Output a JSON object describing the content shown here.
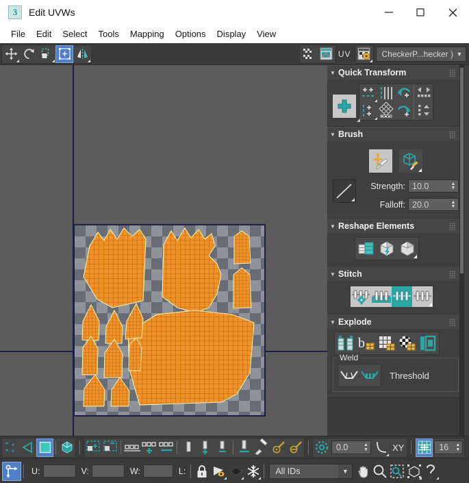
{
  "window": {
    "title": "Edit UVWs",
    "app_icon": "max-logo-icon",
    "minimize": "—",
    "maximize": "☐",
    "close": "✕"
  },
  "menubar": {
    "items": [
      {
        "label": "File"
      },
      {
        "label": "Edit"
      },
      {
        "label": "Select"
      },
      {
        "label": "Tools"
      },
      {
        "label": "Mapping"
      },
      {
        "label": "Options"
      },
      {
        "label": "Display"
      },
      {
        "label": "View"
      }
    ]
  },
  "top_toolbar": {
    "transform_tools": [
      {
        "name": "move-tool",
        "icon": "move-icon",
        "active": false
      },
      {
        "name": "rotate-tool",
        "icon": "rotate-icon",
        "active": false
      },
      {
        "name": "scale-tool",
        "icon": "scale-icon",
        "active": false
      },
      {
        "name": "freeform-mode-tool",
        "icon": "freeform-gizmo-icon",
        "active": true
      },
      {
        "name": "mirror-tool",
        "icon": "mirror-icon",
        "active": false
      }
    ],
    "display_tools": [
      {
        "name": "show-map-toggle",
        "icon": "checker-dots-icon"
      },
      {
        "name": "show-map-button",
        "icon": "map-window-icon"
      }
    ],
    "uv_label": "UV",
    "material_id_button": "material-gear-icon",
    "map_dropdown": {
      "value": "CheckerP...hecker )",
      "arrow": "▼"
    }
  },
  "canvas": {
    "background_color": "#5b5b5b",
    "grid_color": "#1e1e44",
    "uv_tile": {
      "checker_light": "#8f9299",
      "checker_dark": "#686c74",
      "border_color": "#1e1e44"
    },
    "mesh": {
      "fill_color": "#f0932a",
      "edge_color": "#c96a12",
      "outline_color": "#f5f0a0",
      "island_count": 14,
      "description": "unwrapped UV islands of a gloved hand mesh — two palm shells, one large cuff panel, and eleven finger/thumb tubes"
    }
  },
  "panel": {
    "rollouts": [
      {
        "name": "quick-transform",
        "title": "Quick Transform",
        "triangle": "▼",
        "collapsed": false,
        "buttons": [
          {
            "name": "quick-transform-pivot",
            "icon": "pivot-cross-icon"
          },
          {
            "name": "align-horizontal",
            "icon": "align-h-icon"
          },
          {
            "name": "align-vertical",
            "icon": "align-v-icon"
          },
          {
            "name": "space-vertical",
            "icon": "space-v-bars-icon"
          },
          {
            "name": "rotate-ccw-90",
            "icon": "rotate-ccw-icon"
          },
          {
            "name": "align-linear-h",
            "icon": "align-linear-h-icon"
          },
          {
            "name": "align-linear-v",
            "icon": "align-linear-v-icon"
          },
          {
            "name": "align-to-diamond",
            "icon": "diamond-grid-icon"
          },
          {
            "name": "space-horizontal",
            "icon": "space-h-bar-icon"
          },
          {
            "name": "rotate-cw-90",
            "icon": "rotate-cw-icon"
          },
          {
            "name": "snap-horizontal",
            "icon": "snap-lr-icon"
          },
          {
            "name": "snap-vertical",
            "icon": "snap-ud-icon"
          }
        ]
      },
      {
        "name": "brush",
        "title": "Brush",
        "triangle": "▼",
        "collapsed": false,
        "buttons": [
          {
            "name": "paint-move-brush",
            "icon": "paint-move-icon"
          },
          {
            "name": "relax-brush",
            "icon": "relax-cube-brush-icon"
          }
        ],
        "curve_button": {
          "name": "falloff-curve-button",
          "icon": "falloff-curve-icon"
        },
        "fields": [
          {
            "name": "brush-strength",
            "label": "Strength:",
            "value": "10.0"
          },
          {
            "name": "brush-falloff",
            "label": "Falloff:",
            "value": "20.0"
          }
        ]
      },
      {
        "name": "reshape-elements",
        "title": "Reshape Elements",
        "triangle": "▼",
        "collapsed": false,
        "buttons": [
          {
            "name": "relax-button",
            "icon": "relax-panels-icon"
          },
          {
            "name": "quick-peel-button",
            "icon": "peel-lightning-cube-icon"
          },
          {
            "name": "peel-mode-button",
            "icon": "peel-cube-icon"
          }
        ]
      },
      {
        "name": "stitch",
        "title": "Stitch",
        "triangle": "▼",
        "collapsed": false,
        "buttons": [
          {
            "name": "stitch-custom-button",
            "icon": "stitch-gear-icon"
          },
          {
            "name": "stitch-selected-button",
            "icon": "stitch-selected-icon"
          },
          {
            "name": "stitch-diagonal-button",
            "icon": "stitch-diagonal-icon"
          },
          {
            "name": "stitch-source-button",
            "icon": "stitch-source-icon"
          }
        ]
      },
      {
        "name": "explode",
        "title": "Explode",
        "triangle": "▼",
        "collapsed": false,
        "buttons": [
          {
            "name": "break-button",
            "icon": "break-arrows-icon"
          },
          {
            "name": "break-by-angle-button",
            "icon": "break-angle-icon"
          },
          {
            "name": "break-by-face-button",
            "icon": "break-grid-icon"
          },
          {
            "name": "break-by-material-button",
            "icon": "break-checker-icon"
          },
          {
            "name": "break-by-element-button",
            "icon": "break-element-icon"
          }
        ],
        "weld_group": {
          "name": "weld-group",
          "legend": "Weld",
          "threshold_label": "Threshold",
          "buttons": [
            {
              "name": "weld-selected-button",
              "icon": "weld-open-icon"
            },
            {
              "name": "target-weld-button",
              "icon": "weld-target-icon"
            }
          ]
        }
      }
    ],
    "scrollbar": {
      "name": "panel-scrollbar"
    }
  },
  "bottom_toolbar": {
    "selection_modes": [
      {
        "name": "vertex-mode",
        "icon": "vertex-dots-icon",
        "active": false
      },
      {
        "name": "edge-mode",
        "icon": "edge-triangle-icon",
        "active": false
      },
      {
        "name": "face-mode",
        "icon": "face-square-icon",
        "active": true
      },
      {
        "name": "element-mode",
        "icon": "element-cube-icon",
        "active": false
      }
    ],
    "selection_tools": [
      {
        "name": "expand-selection",
        "icon": "expand-select-icon"
      },
      {
        "name": "shrink-selection",
        "icon": "shrink-select-icon"
      },
      {
        "name": "loop-uv-edges",
        "icon": "loop-uv-icon"
      },
      {
        "name": "grow-loop-uv",
        "icon": "grow-loop-icon"
      },
      {
        "name": "ring-uv-edges",
        "icon": "ring-uv-icon"
      },
      {
        "name": "loop-uv-vertical",
        "icon": "loop-v-icon"
      },
      {
        "name": "grow-loop-vertical",
        "icon": "grow-loop-v-icon"
      },
      {
        "name": "shrink-loop-vertical",
        "icon": "shrink-loop-v-icon"
      },
      {
        "name": "align-to-edge",
        "icon": "align-edge-icon"
      },
      {
        "name": "paint-select-brush",
        "icon": "paint-brush-icon"
      },
      {
        "name": "paint-select-inc",
        "icon": "brush-plus-icon"
      },
      {
        "name": "paint-select-dec",
        "icon": "brush-minus-icon"
      }
    ],
    "snap": {
      "name": "snap-toggle",
      "icon": "snap-ring-icon",
      "value": "0.0",
      "curve_icon": "falloff-curve-icon",
      "axis_label": "XY"
    },
    "grid": {
      "name": "grid-toggle",
      "icon": "grid-snap-icon",
      "active": true,
      "value": "16"
    }
  },
  "status_bar": {
    "pivot_button": {
      "name": "pivot-snap-button",
      "icon": "pivot-arrow-icon",
      "active": true
    },
    "coords": [
      {
        "name": "u-field",
        "label": "U:",
        "value": ""
      },
      {
        "name": "v-field",
        "label": "V:",
        "value": ""
      },
      {
        "name": "w-field",
        "label": "W:",
        "value": ""
      },
      {
        "name": "l-field",
        "label": "L:",
        "value": ""
      }
    ],
    "lock_button": {
      "name": "lock-selection-button",
      "icon": "lock-icon"
    },
    "filter_buttons": [
      {
        "name": "filter-selected-faces",
        "icon": "eye-cone-icon"
      },
      {
        "name": "filter-selected-subobject",
        "icon": "dark-diamond-icon"
      },
      {
        "name": "snowflake-filter",
        "icon": "snowflake-icon"
      }
    ],
    "id_dropdown": {
      "name": "material-id-dropdown",
      "value": "All IDs",
      "arrow": "▼"
    },
    "view_tools": [
      {
        "name": "pan-view-button",
        "icon": "hand-icon"
      },
      {
        "name": "zoom-view-button",
        "icon": "magnifier-icon"
      },
      {
        "name": "zoom-region-button",
        "icon": "zoom-region-icon"
      },
      {
        "name": "zoom-extents-button",
        "icon": "zoom-extents-icon"
      },
      {
        "name": "show-hide-help-button",
        "icon": "question-mark-icon"
      }
    ]
  },
  "colors": {
    "accent_teal": "#2aa6a6",
    "accent_blue": "#4f7fc4",
    "mesh_orange": "#f0932a",
    "panel_bg": "#3a3a3a",
    "canvas_bg": "#5b5b5b"
  }
}
